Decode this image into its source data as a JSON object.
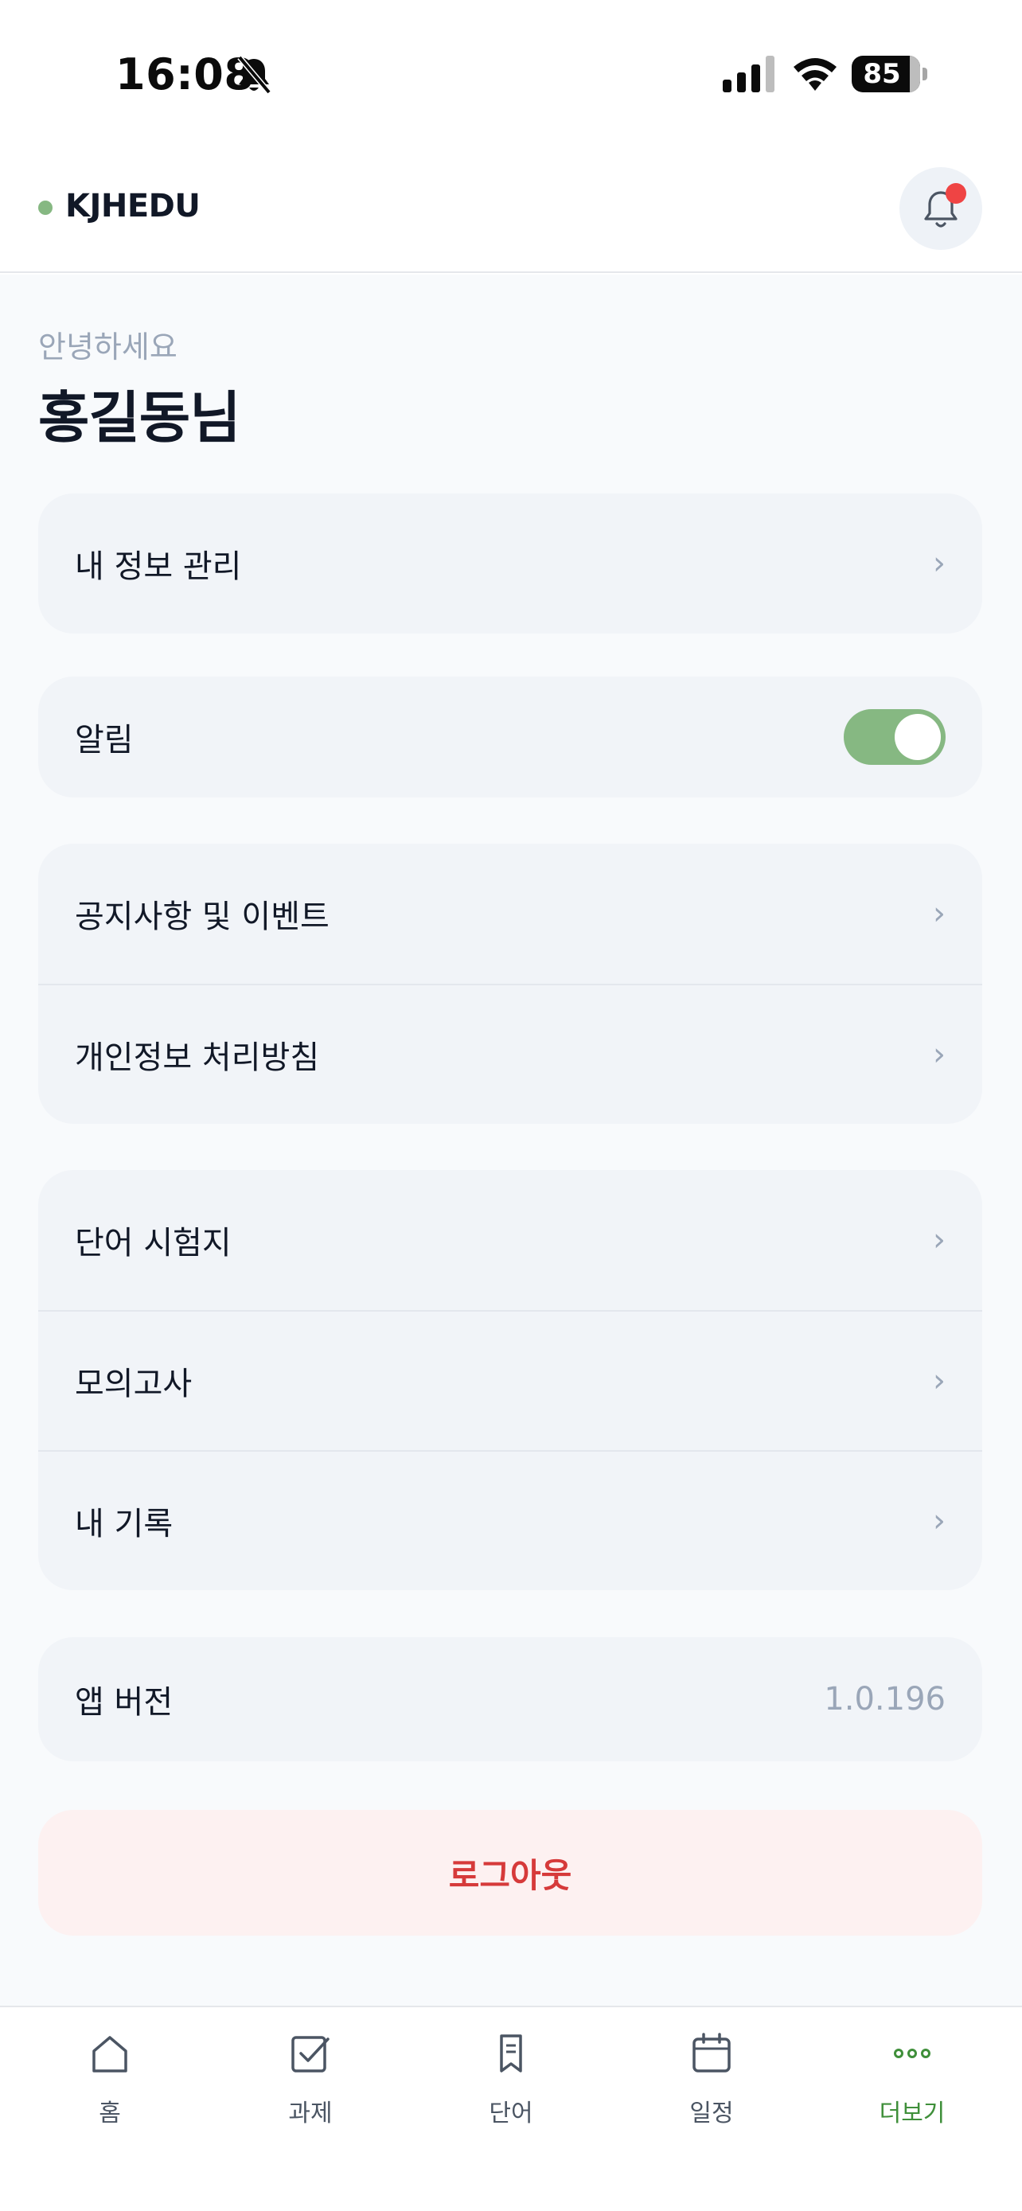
{
  "status_bar": {
    "time": "16:08",
    "battery": "85",
    "battery_level": 0.85
  },
  "header": {
    "brand": "KJHEDU",
    "brand_dot_color": "#86b882",
    "notification_badge_color": "#ef4444"
  },
  "greeting": {
    "subtitle": "안녕하세요",
    "name": "홍길동님"
  },
  "menu": {
    "profile": "내 정보 관리",
    "notifications": "알림",
    "notifications_on": true,
    "notices": "공지사항 및 이벤트",
    "privacy": "개인정보 처리방침",
    "word_test": "단어 시험지",
    "mock_exam": "모의고사",
    "my_records": "내 기록",
    "app_version_label": "앱 버전",
    "app_version_value": "1.0.196",
    "chevron": "›"
  },
  "logout": {
    "label": "로그아웃",
    "color": "#d63a3a"
  },
  "bottom_nav": {
    "items": [
      {
        "label": "홈",
        "icon": "home-icon"
      },
      {
        "label": "과제",
        "icon": "checkbox-icon"
      },
      {
        "label": "단어",
        "icon": "bookmark-icon"
      },
      {
        "label": "일정",
        "icon": "calendar-icon"
      },
      {
        "label": "더보기",
        "icon": "more-dots-icon",
        "active": true
      }
    ],
    "active_color": "#3f8f3a"
  }
}
